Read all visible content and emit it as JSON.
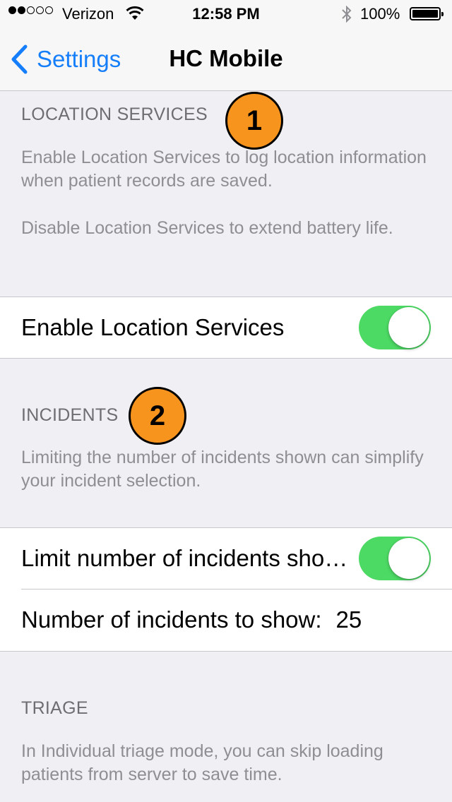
{
  "status_bar": {
    "signal_dots": [
      true,
      true,
      false,
      false,
      false
    ],
    "carrier": "Verizon",
    "time": "12:58 PM",
    "battery": "100%",
    "wifi_icon": "wifi-icon",
    "bluetooth_icon": "bluetooth-icon"
  },
  "nav": {
    "back_label": "Settings",
    "title": "HC Mobile"
  },
  "location": {
    "header": "LOCATION SERVICES",
    "description": "Enable Location Services to log location information when patient records are saved.",
    "description2": "Disable Location Services to extend battery life.",
    "toggle_label": "Enable Location Services",
    "toggle_on": true,
    "badge": "1"
  },
  "incidents": {
    "header": "INCIDENTS",
    "description": "Limiting the number of incidents shown can simplify your incident selection.",
    "limit_label": "Limit number of incidents shown",
    "limit_on": true,
    "count_label": "Number of incidents to show:",
    "count_value": "25",
    "badge": "2"
  },
  "triage": {
    "header": "TRIAGE",
    "description": "In Individual triage mode, you can skip loading patients from server to save time."
  },
  "colors": {
    "accent": "#157efb",
    "toggle_on": "#4cd964",
    "badge": "#f7941d",
    "background": "#efeff4"
  }
}
